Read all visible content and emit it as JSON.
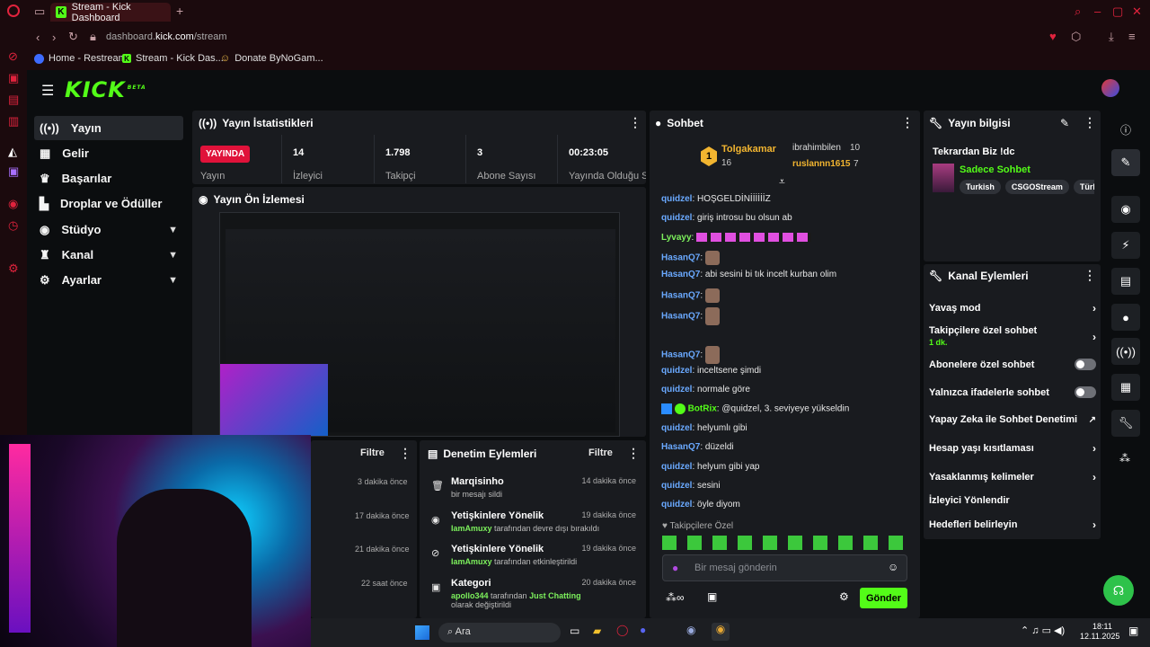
{
  "browser": {
    "tab_title": "Stream - Kick Dashboard",
    "new_tab": "+",
    "url_prefix": "dashboard.",
    "url_domain": "kick.com",
    "url_path": "/stream",
    "bookmarks": [
      {
        "label": "Home - Restream"
      },
      {
        "label": "Stream - Kick Das..."
      },
      {
        "label": "Donate ByNoGam..."
      }
    ]
  },
  "nav": {
    "logo": "KICK",
    "beta": "BETA",
    "items": [
      {
        "label": "Yayın"
      },
      {
        "label": "Gelir"
      },
      {
        "label": "Başarılar"
      },
      {
        "label": "Droplar ve Ödüller"
      },
      {
        "label": "Stüdyo"
      },
      {
        "label": "Kanal"
      },
      {
        "label": "Ayarlar"
      }
    ]
  },
  "stats": {
    "title": "Yayın İstatistikleri",
    "live": "YAYINDA",
    "live_label": "Yayın",
    "viewers": "14",
    "viewers_label": "İzleyici",
    "followers": "1.798",
    "followers_label": "Takipçi",
    "subs": "3",
    "subs_label": "Abone Sayısı",
    "duration": "00:23:05",
    "duration_label": "Yayında Olduğu Süre"
  },
  "preview": {
    "title": "Yayın Ön İzlemesi"
  },
  "left_log": {
    "filter": "Filtre",
    "items": [
      {
        "time": "3 dakika önce"
      },
      {
        "time": "17 dakika önce"
      },
      {
        "time": "21 dakika önce"
      },
      {
        "time": "22 saat önce"
      }
    ]
  },
  "mod_log": {
    "title": "Denetim Eylemleri",
    "filter": "Filtre",
    "items": [
      {
        "user": "Marqisinho",
        "desc": "bir mesajı sildi",
        "time": "14 dakika önce"
      },
      {
        "user": "Yetişkinlere Yönelik",
        "by": "IamAmuxy",
        "desc": "tarafından devre dışı bırakıldı",
        "time": "19 dakika önce"
      },
      {
        "user": "Yetişkinlere Yönelik",
        "by": "IamAmuxy",
        "desc": "tarafından etkinleştirildi",
        "time": "19 dakika önce"
      },
      {
        "user": "Kategori",
        "by": "apollo344",
        "desc": "tarafından",
        "cat": "Just Chatting",
        "desc2": "olarak değiştirildi",
        "time": "20 dakika önce"
      }
    ]
  },
  "chat": {
    "title": "Sohbet",
    "top": {
      "rank": "1",
      "name": "Tolgakamar",
      "count": "16",
      "u2": "ibrahimbilen",
      "c2": "10",
      "u3": "ruslannn1615",
      "c3": "7"
    },
    "messages": [
      {
        "user": "quidzel",
        "text": "HOŞGELDİNİİİİİİZ"
      },
      {
        "user": "quidzel",
        "text": "giriş introsu bu olsun ab"
      },
      {
        "user": "Lyvayy",
        "text": ""
      },
      {
        "user": "HasanQ7",
        "text": ""
      },
      {
        "user": "HasanQ7",
        "text": "abi sesini bi tık incelt kurban olim"
      },
      {
        "user": "HasanQ7",
        "text": ""
      },
      {
        "user": "HasanQ7",
        "text": ""
      },
      {
        "user": "HasanQ7",
        "text": ""
      },
      {
        "user": "quidzel",
        "text": "inceltsene şimdi"
      },
      {
        "user": "quidzel",
        "text": "normale göre"
      },
      {
        "user": "BotRix",
        "text": "@quidzel, 3. seviyeye yükseldin"
      },
      {
        "user": "quidzel",
        "text": "helyumlı gibi"
      },
      {
        "user": "HasanQ7",
        "text": "düzeldi"
      },
      {
        "user": "quidzel",
        "text": "helyum gibi yap"
      },
      {
        "user": "quidzel",
        "text": "sesini"
      },
      {
        "user": "quidzel",
        "text": "öyle diyom"
      }
    ],
    "follower_only": "Takipçilere Özel",
    "placeholder": "Bir mesaj gönderin",
    "send": "Gönder"
  },
  "info": {
    "title": "Yayın bilgisi",
    "stream_title": "Tekrardan Biz !dc",
    "category": "Sadece Sohbet",
    "tags": [
      "Turkish",
      "CSGOStream",
      "Türkç"
    ]
  },
  "actions": {
    "title": "Kanal Eylemleri",
    "items": [
      {
        "label": "Yavaş mod"
      },
      {
        "label": "Takipçilere özel sohbet",
        "sub": "1 dk."
      },
      {
        "label": "Abonelere özel sohbet"
      },
      {
        "label": "Yalnızca ifadelerle sohbet"
      },
      {
        "label": "Yapay Zeka ile Sohbet Denetimi"
      },
      {
        "label": "Hesap yaşı kısıtlaması"
      },
      {
        "label": "Yasaklanmış kelimeler"
      },
      {
        "label": "İzleyici Yönlendir"
      },
      {
        "label": "Hedefleri belirleyin"
      }
    ]
  },
  "taskbar": {
    "search": "Ara",
    "time": "18:11",
    "date": "12.11.2025"
  },
  "colors": {
    "accent": "#53fc18",
    "panel": "#191b1f",
    "live": "#e0123a"
  }
}
